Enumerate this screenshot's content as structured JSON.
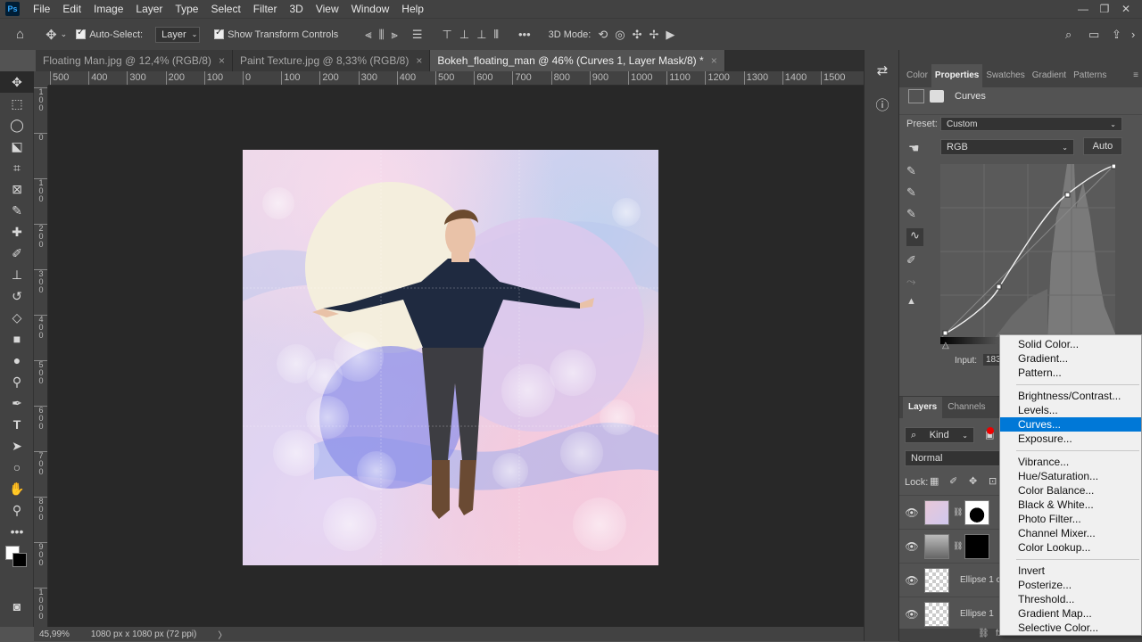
{
  "menubar": {
    "app_logo": "Ps",
    "items": [
      "File",
      "Edit",
      "Image",
      "Layer",
      "Type",
      "Select",
      "Filter",
      "3D",
      "View",
      "Window",
      "Help"
    ]
  },
  "options_bar": {
    "auto_select_label": "Auto-Select:",
    "auto_select_value": "Layer",
    "show_transform_label": "Show Transform Controls",
    "mode_3d_label": "3D Mode:",
    "more_label": "•••"
  },
  "tabs": [
    {
      "label": "Floating Man.jpg @ 12,4% (RGB/8)",
      "close": "×"
    },
    {
      "label": "Paint Texture.jpg @ 8,33% (RGB/8)",
      "close": "×"
    },
    {
      "label": "Bokeh_floating_man @ 46% (Curves 1, Layer Mask/8) *",
      "close": "×"
    }
  ],
  "ruler": {
    "top_ticks": [
      "500",
      "400",
      "300",
      "200",
      "100",
      "0",
      "100",
      "200",
      "300",
      "400",
      "500",
      "600",
      "700",
      "800",
      "900",
      "1000",
      "1100",
      "1200",
      "1300",
      "1400",
      "1500"
    ],
    "left_ticks": [
      "100",
      "0",
      "100",
      "200",
      "300",
      "400",
      "500",
      "600",
      "700",
      "800",
      "900",
      "1000"
    ]
  },
  "status": {
    "zoom": "45,99%",
    "doc_size": "1080 px x 1080 px (72 ppi)",
    "arrow": "〉"
  },
  "properties": {
    "tabs": [
      "Color",
      "Properties",
      "Swatches",
      "Gradient",
      "Patterns"
    ],
    "active_tab": "Properties",
    "adjustment_name": "Curves",
    "preset_label": "Preset:",
    "preset_value": "Custom",
    "channel_value": "RGB",
    "auto_button": "Auto",
    "input_label": "Input:",
    "input_value": "183"
  },
  "layers": {
    "tabs": [
      "Layers",
      "Channels"
    ],
    "kind_label": "Kind",
    "blend_mode": "Normal",
    "lock_label": "Lock:",
    "rows": [
      {
        "name": ""
      },
      {
        "name": ""
      },
      {
        "name": "Ellipse 1 c"
      },
      {
        "name": "Ellipse 1"
      }
    ]
  },
  "adjustment_menu": {
    "groups": [
      [
        "Solid Color...",
        "Gradient...",
        "Pattern..."
      ],
      [
        "Brightness/Contrast...",
        "Levels...",
        "Curves...",
        "Exposure..."
      ],
      [
        "Vibrance...",
        "Hue/Saturation...",
        "Color Balance...",
        "Black & White...",
        "Photo Filter...",
        "Channel Mixer...",
        "Color Lookup..."
      ],
      [
        "Invert",
        "Posterize...",
        "Threshold...",
        "Gradient Map...",
        "Selective Color..."
      ]
    ],
    "highlighted": "Curves..."
  },
  "colors": {
    "highlight": "#0078d7",
    "ui_dark": "#424242",
    "canvas_bg": "#282828"
  }
}
